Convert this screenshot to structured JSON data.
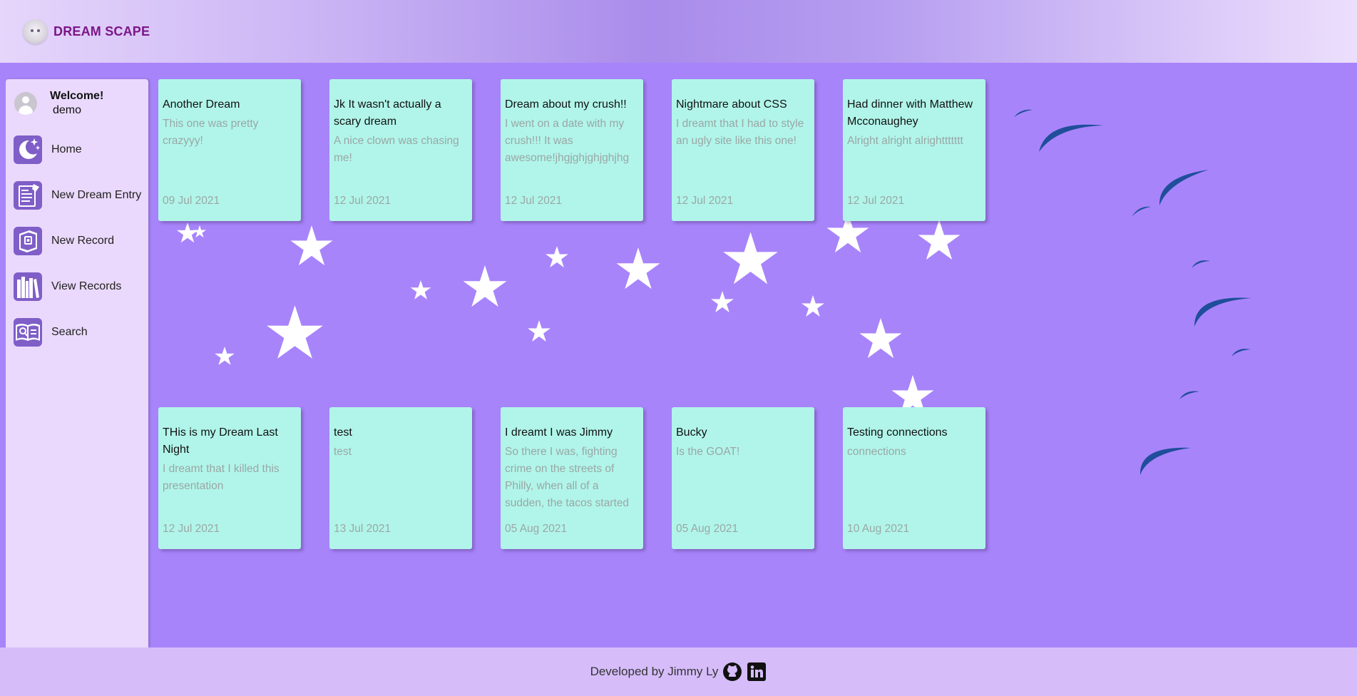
{
  "app": {
    "name": "DREAM SCAPE",
    "brand_color": "#7b1687"
  },
  "user": {
    "greeting": "Welcome!",
    "username": "demo"
  },
  "sidebar": {
    "items": [
      {
        "label": "Home",
        "icon": "moon-stars-icon"
      },
      {
        "label": "New Dream Entry",
        "icon": "journal-entry-icon"
      },
      {
        "label": "New Record",
        "icon": "record-book-icon"
      },
      {
        "label": "View Records",
        "icon": "bookshelf-icon"
      },
      {
        "label": "Search",
        "icon": "open-book-search-icon"
      }
    ]
  },
  "dreams": [
    {
      "title": "Another Dream",
      "body": "This one was pretty crazyyy!",
      "date": "09 Jul 2021"
    },
    {
      "title": "Jk It wasn't actually a scary dream",
      "body": "A nice clown was chasing me!",
      "date": "12 Jul 2021"
    },
    {
      "title": "Dream about my crush!!",
      "body": "I went on a date with my crush!!! It was awesome!jhgjghjghjghjhg",
      "date": "12 Jul 2021"
    },
    {
      "title": "Nightmare about CSS",
      "body": "I dreamt that I had to style an ugly site like this one!",
      "date": "12 Jul 2021"
    },
    {
      "title": "Had dinner with Matthew Mcconaughey",
      "body": "Alright alright alrighttttttt",
      "date": "12 Jul 2021"
    },
    {
      "title": "THis is my Dream Last Night",
      "body": "I dreamt that I killed this presentation",
      "date": "12 Jul 2021"
    },
    {
      "title": "test",
      "body": "test",
      "date": "13 Jul 2021"
    },
    {
      "title": "I dreamt I was Jimmy",
      "body": "So there I was, fighting crime on the streets of Philly, when all of a sudden, the tacos started raining down from the sky",
      "date": "05 Aug 2021"
    },
    {
      "title": "Bucky",
      "body": "Is the GOAT!",
      "date": "05 Aug 2021"
    },
    {
      "title": "Testing connections",
      "body": "connections",
      "date": "10 Aug 2021"
    }
  ],
  "footer": {
    "text": "Developed by Jimmy Ly",
    "links": [
      "github-icon",
      "linkedin-icon"
    ]
  },
  "colors": {
    "background": "#a884fb",
    "card": "#b1f5ea",
    "sidebar": "#ead9fc",
    "moon": "#f2cd7e",
    "crater": "#1f4e9a"
  }
}
